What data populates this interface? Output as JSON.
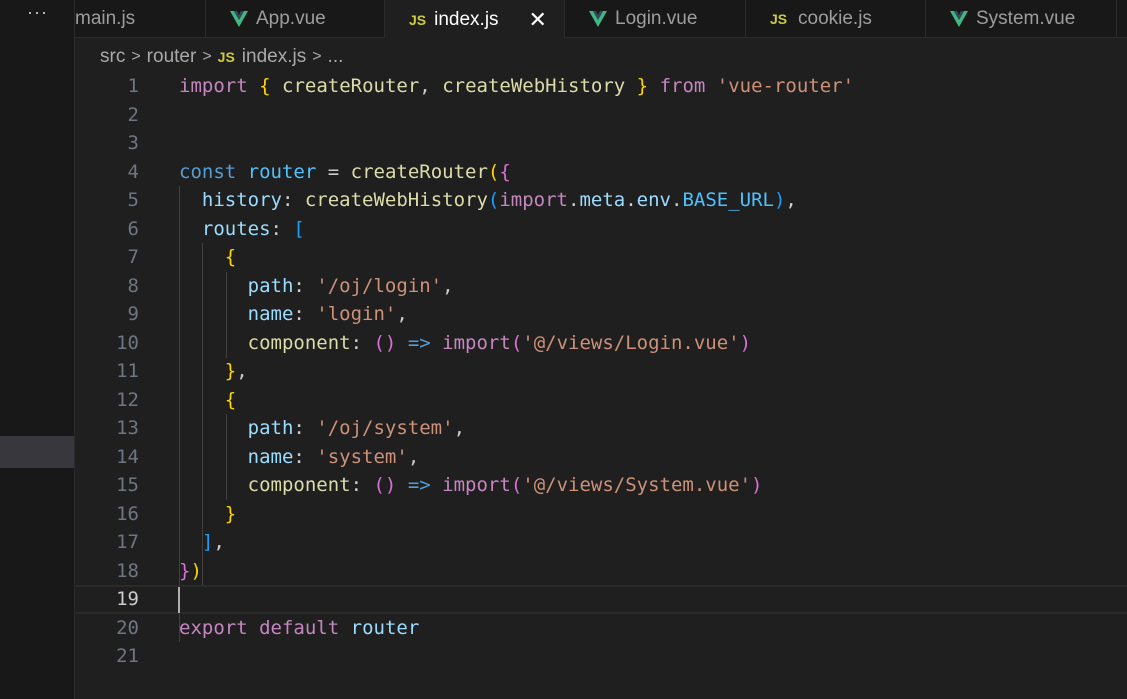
{
  "sidebar": {
    "more_label": "···"
  },
  "tabs": [
    {
      "label": "main.js",
      "icon": "js-icon",
      "active": false
    },
    {
      "label": "App.vue",
      "icon": "vue-icon",
      "active": false
    },
    {
      "label": "index.js",
      "icon": "js-icon",
      "active": true
    },
    {
      "label": "Login.vue",
      "icon": "vue-icon",
      "active": false
    },
    {
      "label": "cookie.js",
      "icon": "js-icon",
      "active": false
    },
    {
      "label": "System.vue",
      "icon": "vue-icon",
      "active": false
    }
  ],
  "tab_icons": {
    "js": "JS",
    "close": "✕"
  },
  "breadcrumb": {
    "part1": "src",
    "part2": "router",
    "file": "index.js",
    "more": "...",
    "sep": ">"
  },
  "editor": {
    "line_numbers": [
      "1",
      "2",
      "3",
      "4",
      "5",
      "6",
      "7",
      "8",
      "9",
      "10",
      "11",
      "12",
      "13",
      "14",
      "15",
      "16",
      "17",
      "18",
      "19",
      "20",
      "21"
    ],
    "current_line": "19",
    "code": {
      "l1": {
        "import": "import",
        "open": "{",
        "createRouter": "createRouter",
        "comma": ",",
        "createWebHistory": "createWebHistory",
        "close": "}",
        "from": "from",
        "module": "'vue-router'"
      },
      "l4": {
        "const": "const",
        "router": "router",
        "eq": " = ",
        "createRouter": "createRouter",
        "paren": "(",
        "brace": "{"
      },
      "l5": {
        "history": "history",
        "colon": ": ",
        "createWebHistory": "createWebHistory",
        "paren_open": "(",
        "import": "import",
        "dot1": ".",
        "meta": "meta",
        "dot2": ".",
        "env": "env",
        "dot3": ".",
        "base": "BASE_URL",
        "paren_close": ")",
        "comma": ","
      },
      "l6": {
        "routes": "routes",
        "colon": ": ",
        "bracket": "["
      },
      "l7": {
        "brace": "{"
      },
      "l8": {
        "key": "path",
        "colon": ": ",
        "value": "'/oj/login'",
        "comma": ","
      },
      "l9": {
        "key": "name",
        "colon": ": ",
        "value": "'login'",
        "comma": ","
      },
      "l10": {
        "key": "component",
        "colon": ": ",
        "parens": "()",
        "arrow": "=>",
        "import": "import",
        "paren_open": "(",
        "value": "'@/views/Login.vue'",
        "paren_close": ")"
      },
      "l11": {
        "brace": "}",
        "comma": ","
      },
      "l12": {
        "brace": "{"
      },
      "l13": {
        "key": "path",
        "colon": ": ",
        "value": "'/oj/system'",
        "comma": ","
      },
      "l14": {
        "key": "name",
        "colon": ": ",
        "value": "'system'",
        "comma": ","
      },
      "l15": {
        "key": "component",
        "colon": ": ",
        "parens": "()",
        "arrow": "=>",
        "import": "import",
        "paren_open": "(",
        "value": "'@/views/System.vue'",
        "paren_close": ")"
      },
      "l16": {
        "brace": "}"
      },
      "l17": {
        "bracket": "]",
        "comma": ","
      },
      "l18": {
        "brace": "}",
        "paren": ")"
      },
      "l20": {
        "export": "export",
        "default": "default",
        "router": "router"
      }
    }
  },
  "colors": {
    "editor_bg": "#1f1f1f",
    "keyword": "#569cd6",
    "control_keyword": "#c586c0",
    "function": "#dcdcaa",
    "variable": "#9cdcfe",
    "string": "#ce9178",
    "constant": "#4fc1ff",
    "bracket1": "#ffd700",
    "bracket2": "#da70d6",
    "bracket3": "#179fff",
    "js_icon": "#cbcb41",
    "vue_icon": "#41b883"
  }
}
